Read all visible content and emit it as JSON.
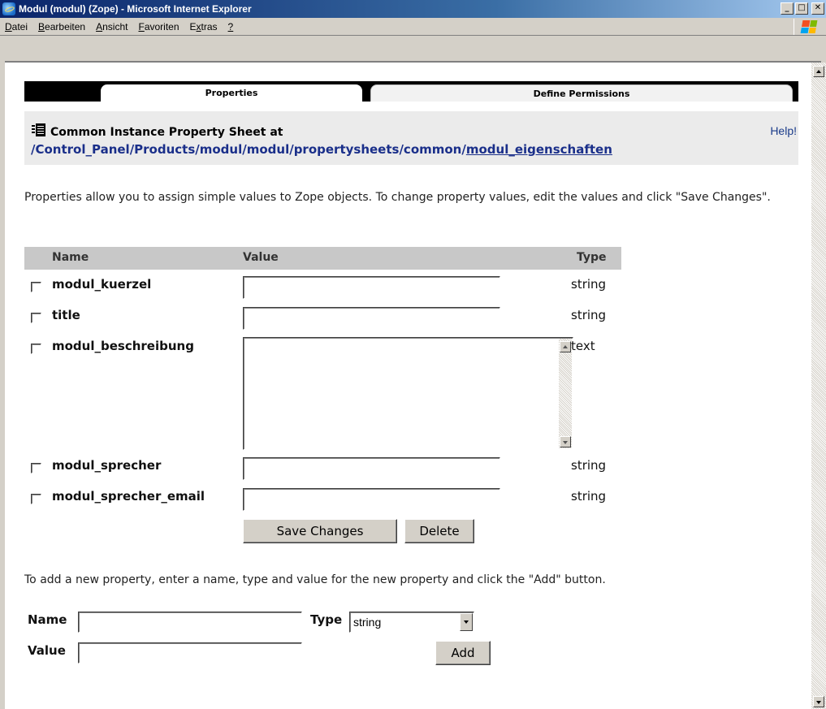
{
  "window": {
    "title": "Modul (modul) (Zope) - Microsoft Internet Explorer",
    "minimize": "_",
    "maximize": "□",
    "close": "✕"
  },
  "menu": [
    {
      "label": "Datei",
      "accel": "D",
      "rest": "atei"
    },
    {
      "label": "Bearbeiten",
      "accel": "B",
      "rest": "earbeiten"
    },
    {
      "label": "Ansicht",
      "accel": "A",
      "rest": "nsicht"
    },
    {
      "label": "Favoriten",
      "accel": "F",
      "rest": "avoriten"
    },
    {
      "label": "Extras",
      "pre": "E",
      "accel": "x",
      "rest": "tras"
    },
    {
      "label": "?",
      "accel": "?",
      "rest": ""
    }
  ],
  "tabs": {
    "active": "Properties",
    "inactive": "Define Permissions"
  },
  "header": {
    "title": "Common Instance Property Sheet at",
    "help": "Help!",
    "path_prefix": "/Control_Panel/Products/modul/modul/propertysheets/common/",
    "path_last": "modul_eigenschaften"
  },
  "intro": "Properties allow you to assign simple values to Zope objects. To change property values, edit the values and click \"Save Changes\".",
  "table": {
    "headers": {
      "name": "Name",
      "value": "Value",
      "type": "Type"
    },
    "rows": [
      {
        "name": "modul_kuerzel",
        "value": "",
        "type": "string"
      },
      {
        "name": "title",
        "value": "",
        "type": "string"
      },
      {
        "name": "modul_beschreibung",
        "value": "",
        "type": "text"
      },
      {
        "name": "modul_sprecher",
        "value": "",
        "type": "string"
      },
      {
        "name": "modul_sprecher_email",
        "value": "",
        "type": "string"
      }
    ]
  },
  "buttons": {
    "save": "Save Changes",
    "delete": "Delete",
    "add": "Add"
  },
  "add_form": {
    "intro": "To add a new property, enter a name, type and value for the new property and click the \"Add\" button.",
    "name_label": "Name",
    "type_label": "Type",
    "value_label": "Value",
    "type_selected": "string",
    "name_value": "",
    "value_value": ""
  }
}
